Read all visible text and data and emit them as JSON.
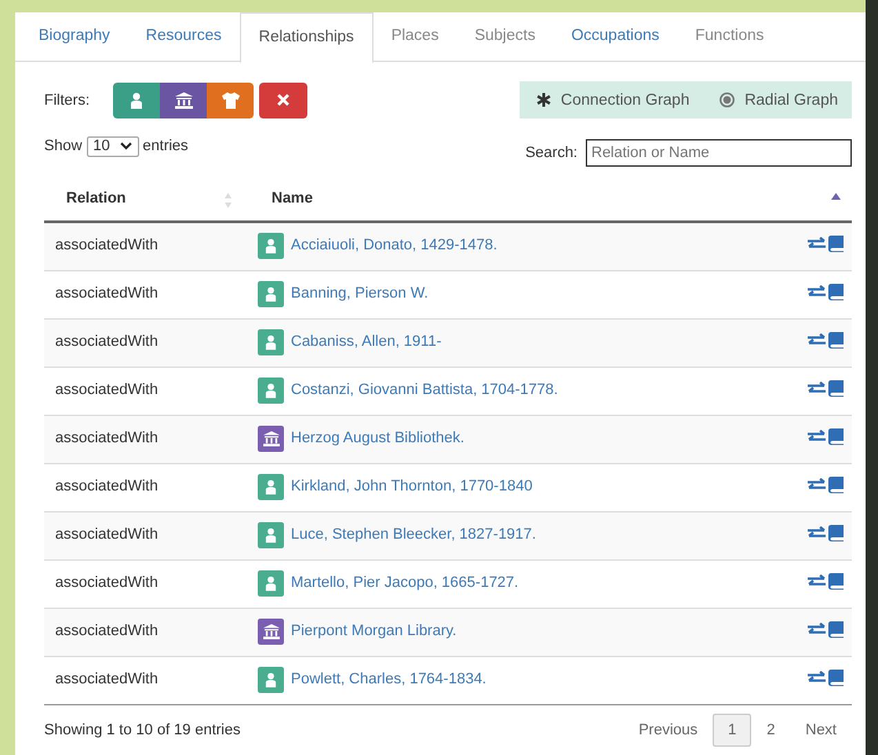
{
  "tabs": [
    {
      "label": "Biography",
      "selected": false,
      "disabled": false
    },
    {
      "label": "Resources",
      "selected": false,
      "disabled": false
    },
    {
      "label": "Relationships",
      "selected": true,
      "disabled": false
    },
    {
      "label": "Places",
      "selected": false,
      "disabled": true
    },
    {
      "label": "Subjects",
      "selected": false,
      "disabled": true
    },
    {
      "label": "Occupations",
      "selected": false,
      "disabled": false
    },
    {
      "label": "Functions",
      "selected": false,
      "disabled": true
    }
  ],
  "filters": {
    "label": "Filters:",
    "buttons": [
      {
        "kind": "person"
      },
      {
        "kind": "corporate"
      },
      {
        "kind": "family"
      },
      {
        "kind": "clear"
      }
    ]
  },
  "graphs": [
    "Connection Graph",
    "Radial Graph"
  ],
  "length_menu": {
    "before": "Show",
    "value": "10",
    "after": "entries"
  },
  "search": {
    "label": "Search:",
    "placeholder": "Relation or Name"
  },
  "table": {
    "columns": [
      "Relation",
      "Name"
    ],
    "rows": [
      {
        "relation": "associatedWith",
        "kind": "person",
        "name": "Acciaiuoli, Donato, 1429-1478."
      },
      {
        "relation": "associatedWith",
        "kind": "person",
        "name": "Banning, Pierson W."
      },
      {
        "relation": "associatedWith",
        "kind": "person",
        "name": "Cabaniss, Allen, 1911-"
      },
      {
        "relation": "associatedWith",
        "kind": "person",
        "name": "Costanzi, Giovanni Battista, 1704-1778."
      },
      {
        "relation": "associatedWith",
        "kind": "corporate",
        "name": "Herzog August Bibliothek."
      },
      {
        "relation": "associatedWith",
        "kind": "person",
        "name": "Kirkland, John Thornton, 1770-1840"
      },
      {
        "relation": "associatedWith",
        "kind": "person",
        "name": "Luce, Stephen Bleecker, 1827-1917."
      },
      {
        "relation": "associatedWith",
        "kind": "person",
        "name": "Martello, Pier Jacopo, 1665-1727."
      },
      {
        "relation": "associatedWith",
        "kind": "corporate",
        "name": "Pierpont Morgan Library."
      },
      {
        "relation": "associatedWith",
        "kind": "person",
        "name": "Powlett, Charles, 1764-1834."
      }
    ]
  },
  "info": "Showing 1 to 10 of 19 entries",
  "pagination": [
    {
      "label": "Previous",
      "selected": false
    },
    {
      "label": "1",
      "selected": true
    },
    {
      "label": "2",
      "selected": false
    },
    {
      "label": "Next",
      "selected": false
    }
  ]
}
